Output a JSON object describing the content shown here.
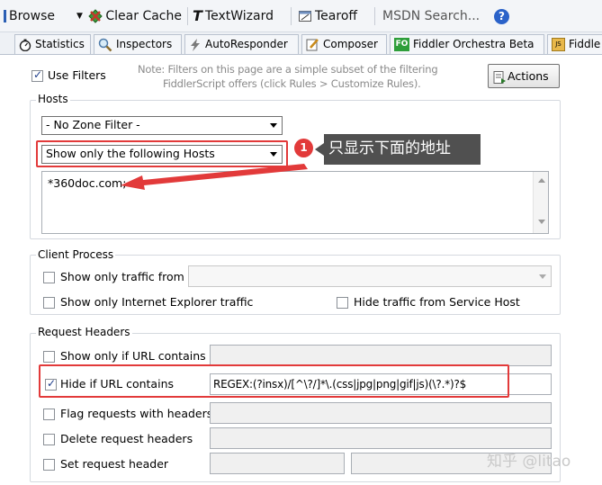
{
  "toolbar": {
    "browse": "Browse",
    "clear_cache": "Clear Cache",
    "text_wizard": "TextWizard",
    "tearoff": "Tearoff",
    "msdn_search": "MSDN Search..."
  },
  "tabs": [
    {
      "label": "Statistics"
    },
    {
      "label": "Inspectors"
    },
    {
      "label": "AutoResponder"
    },
    {
      "label": "Composer"
    },
    {
      "label": "Fiddler Orchestra Beta",
      "badge": "FO"
    },
    {
      "label": "Fiddle"
    }
  ],
  "filters": {
    "use_filters_label": "Use Filters",
    "use_filters_checked": true,
    "note_line1": "Note: Filters on this page are a simple subset of the filtering",
    "note_line2": "FiddlerScript offers (click Rules > Customize Rules).",
    "actions_label": "Actions"
  },
  "hosts": {
    "title": "Hosts",
    "zone_filter": "- No Zone Filter -",
    "host_filter": "Show only the following Hosts",
    "host_list": "*360doc.com;"
  },
  "annotation": {
    "number": "1",
    "text": "只显示下面的地址",
    "color": "#e23a3a"
  },
  "client_process": {
    "title": "Client Process",
    "show_only_traffic_from": "Show only traffic from",
    "show_only_ie": "Show only Internet Explorer traffic",
    "hide_service_host": "Hide traffic from Service Host"
  },
  "request_headers": {
    "title": "Request Headers",
    "show_if_url": "Show only if URL contains",
    "hide_if_url": "Hide if URL contains",
    "hide_if_url_checked": true,
    "hide_if_url_value": "REGEX:(?insx)/[^\\?/]*\\.(css|jpg|png|gif|js)(\\?.*)?$",
    "flag_with_headers": "Flag requests with headers",
    "delete_headers": "Delete request headers",
    "set_header": "Set request header"
  },
  "watermark": "知乎 @litao"
}
